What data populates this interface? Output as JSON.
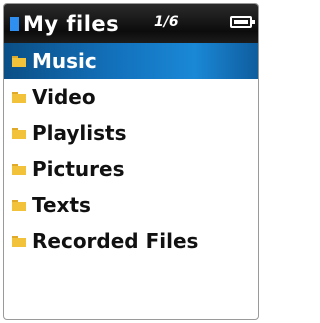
{
  "header": {
    "title": "My files",
    "page_indicator": "1/6",
    "accent_color": "#2f8ff0",
    "battery_icon": "battery-icon"
  },
  "list": {
    "selected_index": 0,
    "items": [
      {
        "label": "Music",
        "icon": "folder-icon"
      },
      {
        "label": "Video",
        "icon": "folder-icon"
      },
      {
        "label": "Playlists",
        "icon": "folder-icon"
      },
      {
        "label": "Pictures",
        "icon": "folder-icon"
      },
      {
        "label": "Texts",
        "icon": "folder-icon"
      },
      {
        "label": "Recorded Files",
        "icon": "folder-icon"
      }
    ]
  }
}
